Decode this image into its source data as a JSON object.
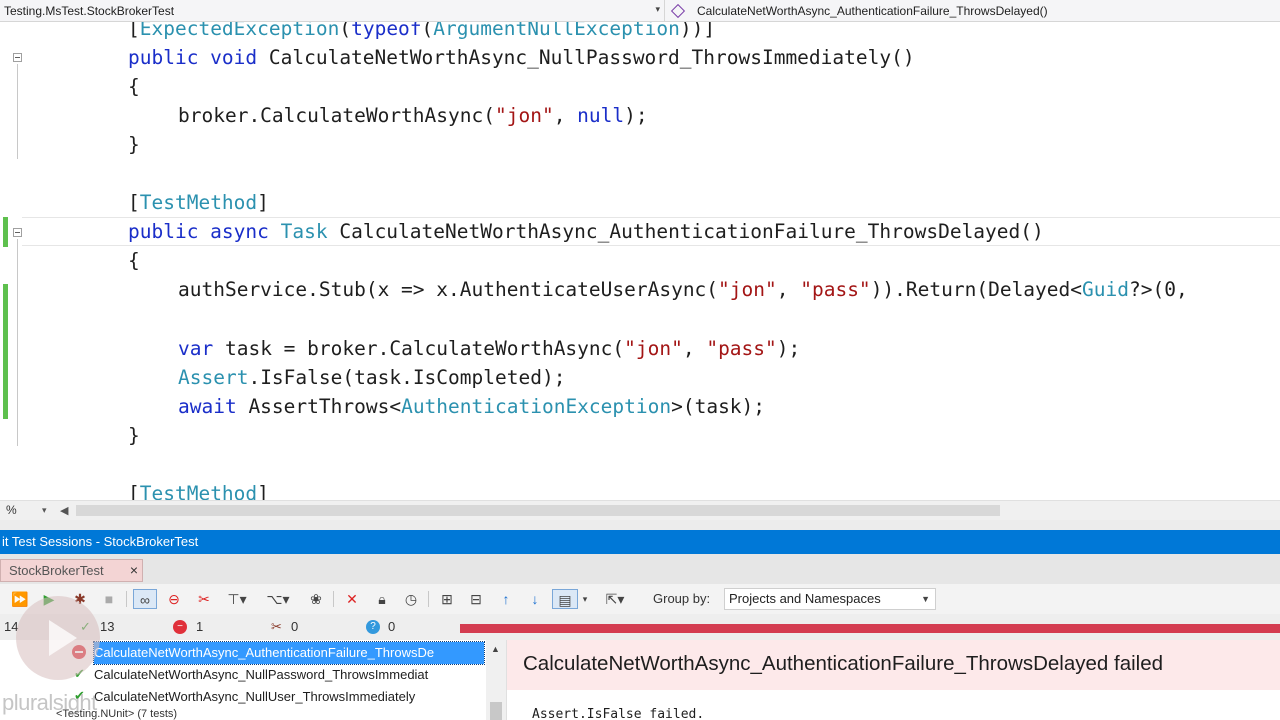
{
  "navbar": {
    "left_label": "Testing.MsTest.StockBrokerTest",
    "right_label": "CalculateNetWorthAsync_AuthenticationFailure_ThrowsDelayed()"
  },
  "code": {
    "line1": {
      "open": "[",
      "attr": "ExpectedException",
      "mid": "(",
      "kw": "typeof",
      "mid2": "(",
      "type": "ArgumentNullException",
      "close": "))]"
    },
    "line2": {
      "kw": "public void",
      "rest": " CalculateNetWorthAsync_NullPassword_ThrowsImmediately()"
    },
    "line3": "{",
    "line4": {
      "a": "broker.CalculateWorthAsync(",
      "s1": "\"jon\"",
      "b": ", ",
      "kw": "null",
      "c": ");"
    },
    "line5": "}",
    "line6": {
      "open": "[",
      "attr": "TestMethod",
      "close": "]"
    },
    "line7": {
      "kw": "public async",
      "sp": " ",
      "type": "Task",
      "rest": " CalculateNetWorthAsync_AuthenticationFailure_ThrowsDelayed()"
    },
    "line8": "{",
    "line9": {
      "a": "authService.Stub(x => x.AuthenticateUserAsync(",
      "s1": "\"jon\"",
      "b": ", ",
      "s2": "\"pass\"",
      "c": ")).Return(Delayed<",
      "type": "Guid",
      "d": "?>(0,"
    },
    "line10": {
      "kw": "var",
      "a": " task = broker.CalculateWorthAsync(",
      "s1": "\"jon\"",
      "b": ", ",
      "s2": "\"pass\"",
      "c": ");"
    },
    "line11": {
      "type": "Assert",
      "rest": ".IsFalse(task.IsCompleted);"
    },
    "line12": {
      "kw": "await",
      "a": " AssertThrows<",
      "type": "AuthenticationException",
      "b": ">(task);"
    },
    "line13": "}",
    "line14": {
      "open": "[",
      "attr": "TestMethod",
      "close": "]"
    }
  },
  "editor_footer": {
    "zoom": "%"
  },
  "panel": {
    "title": "it Test Sessions - StockBrokerTest",
    "tab_label": "StockBrokerTest",
    "tab_close": "×"
  },
  "toolbar": {
    "group_by_label": "Group by:",
    "group_by_value": "Projects and Namespaces",
    "icons": [
      "run-all-icon",
      "run-icon",
      "debug-icon",
      "stop-icon",
      "link-icon",
      "stop-red-icon",
      "wrench-icon",
      "filter-icon",
      "tree-icon",
      "paw-icon",
      "delete-icon",
      "lock-icon",
      "clock-icon",
      "expand-icon",
      "collapse-icon",
      "arrow-up-icon",
      "arrow-down-icon",
      "layout-icon",
      "export-icon"
    ]
  },
  "stats": {
    "total": "14",
    "passed": "13",
    "failed": "1",
    "ignored": "0",
    "unknown": "0"
  },
  "tests": [
    {
      "name": "CalculateNetWorthAsync_AuthenticationFailure_ThrowsDe",
      "status": "failed",
      "selected": true
    },
    {
      "name": "CalculateNetWorthAsync_NullPassword_ThrowsImmediat",
      "status": "passed",
      "selected": false
    },
    {
      "name": "CalculateNetWorthAsync_NullUser_ThrowsImmediately",
      "status": "passed",
      "selected": false
    }
  ],
  "partial_row": "<Testing.NUnit> (7 tests)",
  "detail": {
    "title": "CalculateNetWorthAsync_AuthenticationFailure_ThrowsDelayed failed",
    "message": "Assert.IsFalse failed."
  },
  "watermark": "pluralsight",
  "colors": {
    "accent": "#0078d7",
    "keyword": "#1a2ec9",
    "type": "#2b91af",
    "string": "#a31515",
    "fail": "#d43d51",
    "pass": "#2e9e2e"
  }
}
